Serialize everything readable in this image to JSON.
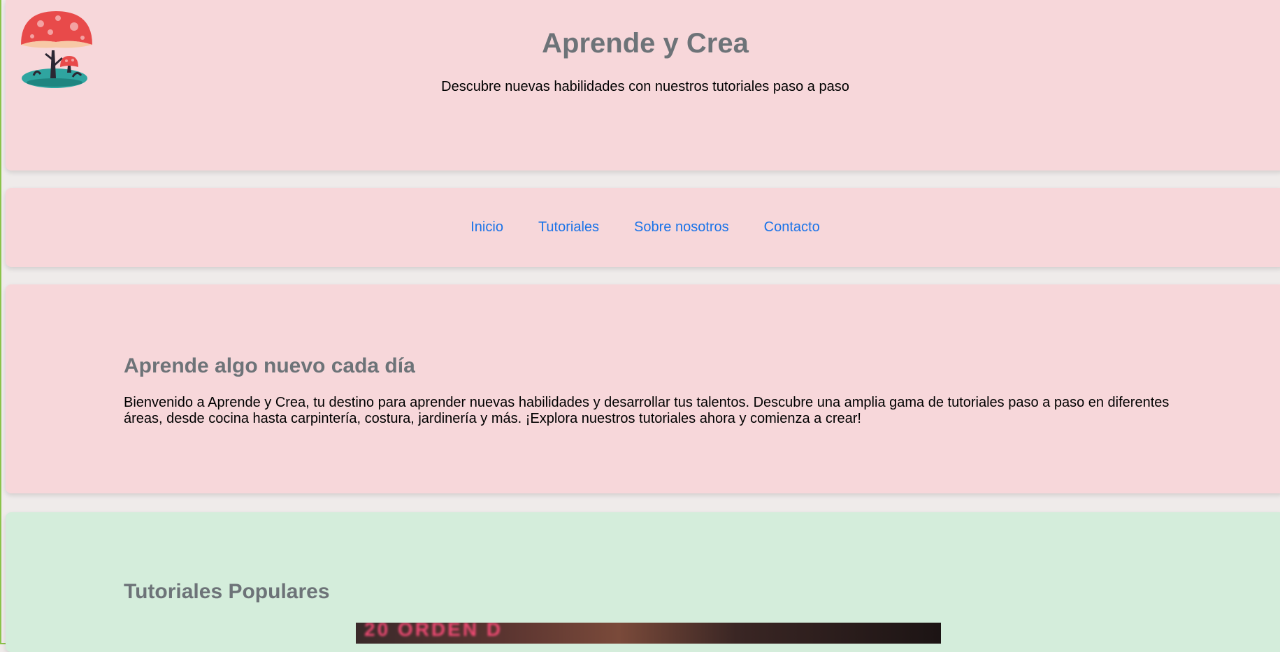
{
  "header": {
    "title": "Aprende y Crea",
    "subtitle": "Descubre nuevas habilidades con nuestros tutoriales paso a paso",
    "logo_icon": "mushroom-tree-icon"
  },
  "nav": {
    "items": [
      {
        "label": "Inicio"
      },
      {
        "label": "Tutoriales"
      },
      {
        "label": "Sobre nosotros"
      },
      {
        "label": "Contacto"
      }
    ]
  },
  "intro": {
    "heading": "Aprende algo nuevo cada día",
    "text": "Bienvenido a Aprende y Crea, tu destino para aprender nuevas habilidades y desarrollar tus talentos. Descubre una amplia gama de tutoriales paso a paso en diferentes áreas, desde cocina hasta carpintería, costura, jardinería y más. ¡Explora nuestros tutoriales ahora y comienza a crear!"
  },
  "popular": {
    "heading": "Tutoriales Populares",
    "video_overlay_text": "20 ORDEN D"
  },
  "colors": {
    "card_pink": "#f7d7da",
    "card_green": "#d4eddb",
    "heading_gray": "#6d7378",
    "link_blue": "#1a73e8",
    "page_bg": "#efebea"
  }
}
